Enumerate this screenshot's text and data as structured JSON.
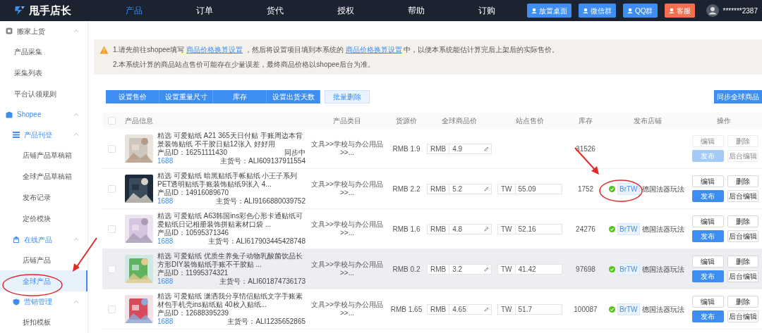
{
  "app": {
    "name": "甩手店长"
  },
  "nav": [
    {
      "label": "产品",
      "selected": true
    },
    {
      "label": "订单",
      "selected": false
    },
    {
      "label": "货代",
      "selected": false
    },
    {
      "label": "授权",
      "selected": false
    },
    {
      "label": "帮助",
      "selected": false
    },
    {
      "label": "订购",
      "selected": false
    }
  ],
  "header_buttons": [
    {
      "label": "放置桌面",
      "kind": "desktop"
    },
    {
      "label": "微信群",
      "kind": "wechat"
    },
    {
      "label": "QQ群",
      "kind": "qq"
    },
    {
      "label": "客服",
      "kind": "service"
    }
  ],
  "user": {
    "name": "*******2387"
  },
  "sidebar": [
    {
      "label": "搬家上货",
      "kind": "move",
      "expanded": true,
      "active": false,
      "children": [
        {
          "label": "产品采集",
          "selected": false
        },
        {
          "label": "采集列表",
          "selected": false
        },
        {
          "label": "平台认领规则",
          "selected": false
        }
      ]
    },
    {
      "label": "Shopee",
      "kind": "shop",
      "expanded": true,
      "active": true,
      "children": [
        {
          "label": "产品刊登",
          "kind": "list",
          "expanded": true,
          "active": true,
          "children": [
            {
              "label": "店铺产品草稿箱",
              "selected": false
            },
            {
              "label": "全球产品草稿箱",
              "selected": false
            },
            {
              "label": "发布记录",
              "selected": false
            },
            {
              "label": "定价模块",
              "selected": false
            }
          ]
        },
        {
          "label": "在线产品",
          "kind": "store",
          "expanded": true,
          "active": true,
          "children": [
            {
              "label": "店铺产品",
              "selected": false
            },
            {
              "label": "全球产品",
              "selected": true
            }
          ]
        },
        {
          "label": "营销管理",
          "kind": "shield",
          "expanded": true,
          "active": true,
          "children": [
            {
              "label": "折扣模板",
              "selected": false
            }
          ]
        }
      ]
    }
  ],
  "notice": {
    "line_1": {
      "before": "1.请先前往shopee填写",
      "link_1": "商品价格换算设置",
      "middle": "，然后将设置项目填到本系统的",
      "link_2": "商品价格换算设置",
      "after": "中，以便本系统能估计算完后上架后的实际售价。"
    },
    "line_2": "2.本系统计算的商品站点售价可能存在少量误差，最终商品价格以shopee后台为准。"
  },
  "toolbar": {
    "group": [
      "设置售价",
      "设置重量尺寸",
      "库存",
      "设置出货天数"
    ],
    "delete": "批量删除",
    "sync": "同步全球商品"
  },
  "table": {
    "header_checked": false,
    "columns": [
      "产品信息",
      "产品类目",
      "货源价",
      "全球商品价",
      "站点售价",
      "库存",
      "发布店铺",
      "操作"
    ],
    "rows": [
      {
        "checked": false,
        "highlighted": false,
        "title": "精选 可爱贴纸 A21 365天日付贴 手账周边本背景装饰贴纸 不干胶日贴12张入 好好用",
        "product_id": "产品ID：16251111430",
        "status": "同步中",
        "source": "1688",
        "sku": "主货号：ALI609137911554",
        "category": "文具>>学校与办公用品>>...",
        "source_price": "RMB 1.9",
        "global_currency": "RMB",
        "global_price": "4.9",
        "stock": "31526",
        "actions": [
          {
            "label": "编辑",
            "kind": "outline",
            "disabled": true
          },
          {
            "label": "删除",
            "kind": "outline",
            "disabled": true
          },
          {
            "label": "发布",
            "kind": "primary",
            "disabled": true
          },
          {
            "label": "后台编辑",
            "kind": "outline",
            "disabled": true
          }
        ]
      },
      {
        "checked": false,
        "highlighted": false,
        "title": "精选 可爱贴纸 暗黑贴纸手帐贴纸 小王子系列 PET透明贴纸手账装饰贴纸9张入 4...",
        "product_id": "产品ID：14916089670",
        "source": "1688",
        "sku": "主货号：ALI9166880039752",
        "category": "文具>>学校与办公用品>>...",
        "source_price": "RMB 2.2",
        "global_currency": "RMB",
        "global_price": "5.2",
        "site_currency": "TW",
        "site_price": "55.09",
        "stock": "1752",
        "shop": {
          "published": true,
          "tag": "BrTW",
          "name": "德国法器玩法"
        },
        "actions": [
          {
            "label": "编辑",
            "kind": "outline",
            "disabled": false
          },
          {
            "label": "删除",
            "kind": "outline",
            "disabled": false
          },
          {
            "label": "发布",
            "kind": "primary",
            "disabled": false
          },
          {
            "label": "后台编辑",
            "kind": "outline",
            "disabled": false
          }
        ]
      },
      {
        "checked": false,
        "highlighted": false,
        "title": "精选 可爱贴纸 A63韩国ins彩色心形卡通贴纸可爱贴纸日记相册装饰拼贴素材口袋 ...",
        "product_id": "产品ID：10595371346",
        "source": "1688",
        "sku": "主货号：ALI617903445428748",
        "category": "文具>>学校与办公用品>>...",
        "source_price": "RMB 1.6",
        "global_currency": "RMB",
        "global_price": "4.8",
        "site_currency": "TW",
        "site_price": "52.16",
        "stock": "24276",
        "shop": {
          "published": true,
          "tag": "BrTW",
          "name": "德国法器玩法"
        },
        "actions": [
          {
            "label": "编辑",
            "kind": "outline",
            "disabled": false
          },
          {
            "label": "删除",
            "kind": "outline",
            "disabled": false
          },
          {
            "label": "发布",
            "kind": "primary",
            "disabled": false
          },
          {
            "label": "后台编辑",
            "kind": "outline",
            "disabled": false
          }
        ]
      },
      {
        "checked": false,
        "highlighted": true,
        "title": "精选 可爱贴纸 优质生养兔子动物乳酸菌饮品长方形DIY装饰贴纸手账不干胶贴 ...",
        "product_id": "产品ID：11995374321",
        "source": "1688",
        "sku": "主货号：ALI601874736173",
        "category": "文具>>学校与办公用品>>...",
        "source_price": "RMB 0.2",
        "global_currency": "RMB",
        "global_price": "3.2",
        "site_currency": "TW",
        "site_price": "41.42",
        "stock": "97698",
        "shop": {
          "published": true,
          "tag": "BrTW",
          "name": "德国法器玩法"
        },
        "actions": [
          {
            "label": "编辑",
            "kind": "outline",
            "disabled": false
          },
          {
            "label": "删除",
            "kind": "outline",
            "disabled": false
          },
          {
            "label": "发布",
            "kind": "primary",
            "disabled": false
          },
          {
            "label": "后台编辑",
            "kind": "outline",
            "disabled": false
          }
        ]
      },
      {
        "checked": false,
        "highlighted": false,
        "title": "精选 可爱贴纸 潇洒我分享情侣贴纸文字手账素材包手机壳ins贴纸贴 40枚入贴纸...",
        "product_id": "产品ID：12688395239",
        "source": "1688",
        "sku": "主货号：ALI1235652865",
        "category": "文具>>学校与办公用品>>...",
        "source_price": "RMB 1.65",
        "global_currency": "RMB",
        "global_price": "4.65",
        "site_currency": "TW",
        "site_price": "51.7",
        "stock": "100087",
        "shop": {
          "published": true,
          "tag": "BrTW",
          "name": "德国法器玩法"
        },
        "actions": [
          {
            "label": "编辑",
            "kind": "outline",
            "disabled": false
          },
          {
            "label": "删除",
            "kind": "outline",
            "disabled": false
          },
          {
            "label": "发布",
            "kind": "primary",
            "disabled": false
          },
          {
            "label": "后台编辑",
            "kind": "outline",
            "disabled": false
          }
        ]
      }
    ]
  }
}
